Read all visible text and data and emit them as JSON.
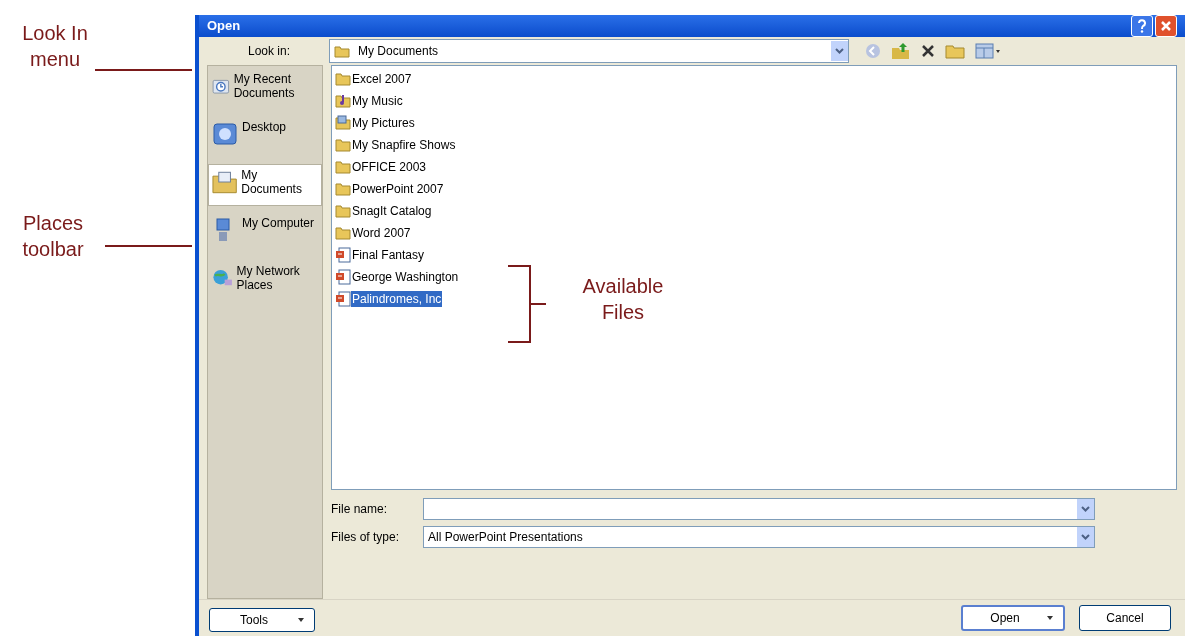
{
  "window": {
    "title": "Open"
  },
  "look_in": {
    "label": "Look in:",
    "value": "My Documents"
  },
  "places": [
    {
      "label": "My Recent Documents",
      "kind": "recent",
      "selected": false
    },
    {
      "label": "Desktop",
      "kind": "desktop",
      "selected": false
    },
    {
      "label": "My Documents",
      "kind": "documents",
      "selected": true
    },
    {
      "label": "My Computer",
      "kind": "computer",
      "selected": false
    },
    {
      "label": "My Network Places",
      "kind": "network",
      "selected": false
    }
  ],
  "files": [
    {
      "name": "Excel 2007",
      "kind": "folder",
      "selected": false
    },
    {
      "name": "My Music",
      "kind": "music",
      "selected": false
    },
    {
      "name": "My Pictures",
      "kind": "pictures",
      "selected": false
    },
    {
      "name": "My Snapfire Shows",
      "kind": "folder",
      "selected": false
    },
    {
      "name": "OFFICE 2003",
      "kind": "folder",
      "selected": false
    },
    {
      "name": "PowerPoint 2007",
      "kind": "folder",
      "selected": false
    },
    {
      "name": "SnagIt Catalog",
      "kind": "folder",
      "selected": false
    },
    {
      "name": "Word 2007",
      "kind": "folder",
      "selected": false
    },
    {
      "name": "Final Fantasy",
      "kind": "presentation",
      "selected": false
    },
    {
      "name": "George Washington",
      "kind": "presentation",
      "selected": false
    },
    {
      "name": "Palindromes, Inc",
      "kind": "presentation",
      "selected": true
    }
  ],
  "file_name": {
    "label": "File name:"
  },
  "file_type": {
    "label": "Files of type:",
    "value": "All PowerPoint Presentations"
  },
  "buttons": {
    "tools": "Tools",
    "open": "Open",
    "cancel": "Cancel"
  },
  "annotations": [
    {
      "label": "Look In menu",
      "kind": "line"
    },
    {
      "label": "Places toolbar",
      "kind": "line"
    },
    {
      "label": "Available Files",
      "kind": "bracket"
    }
  ]
}
